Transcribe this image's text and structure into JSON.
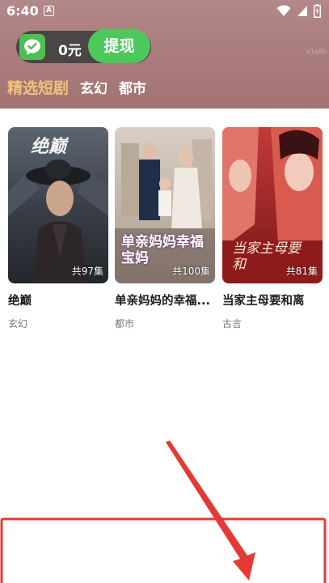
{
  "status_bar": {
    "time": "6:40",
    "notification_letter": "A",
    "icons": [
      "wifi-icon",
      "signal-icon",
      "battery-icon"
    ]
  },
  "wallet": {
    "balance": "0元",
    "withdraw_label": "提现",
    "faint_text": "e1a8b"
  },
  "tabs": [
    {
      "label": "精选短剧",
      "active": true
    },
    {
      "label": "玄幻",
      "active": false
    },
    {
      "label": "都市",
      "active": false
    }
  ],
  "dramas": [
    {
      "title": "绝巅",
      "episodes": "共97集",
      "genre": "玄幻",
      "poster_text": "绝巅"
    },
    {
      "title": "单亲妈妈的幸福...",
      "episodes": "共100集",
      "genre": "都市",
      "poster_text": "单亲妈妈幸福宝妈"
    },
    {
      "title": "当家主母要和离",
      "episodes": "共81集",
      "genre": "古言",
      "poster_text": "当家主母要和"
    }
  ],
  "colors": {
    "header": "#a97b7b",
    "active_tab": "#f3c27a",
    "withdraw_green": "#4cc95a",
    "annotation_red": "#e53935"
  }
}
